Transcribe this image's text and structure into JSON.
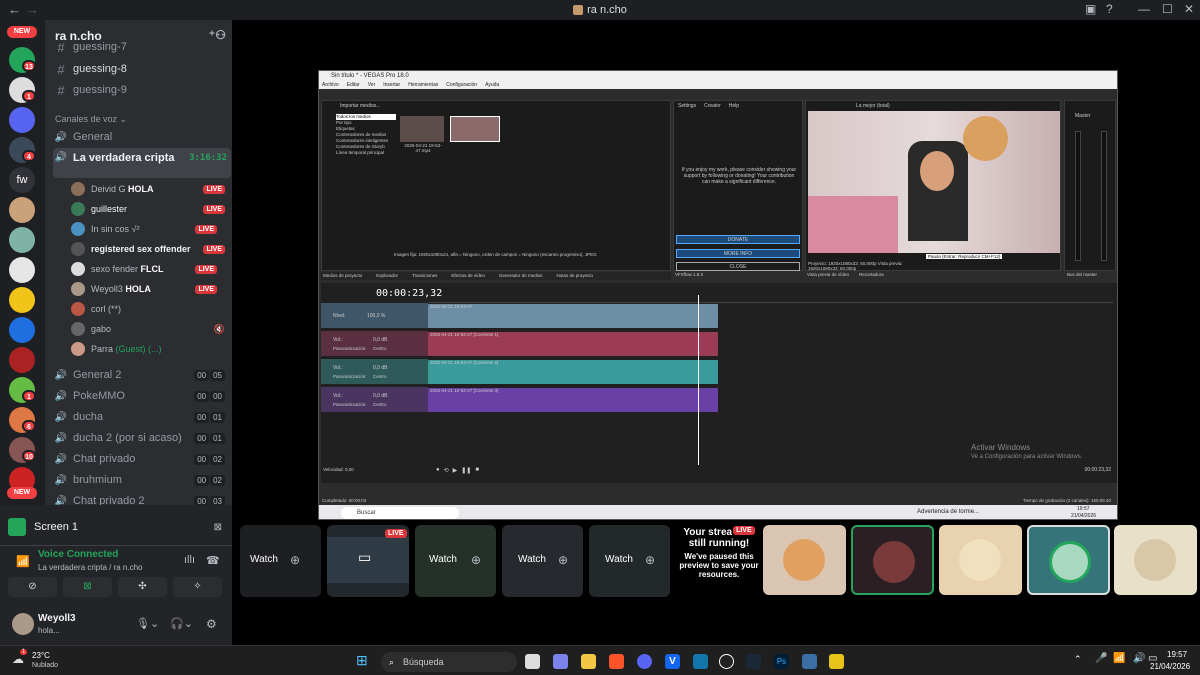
{
  "window": {
    "title": "ra n.cho",
    "back": "←",
    "forward": "→"
  },
  "server_badges": {
    "new_top": "NEW",
    "b1": "13",
    "b2": "1",
    "b3": "4",
    "b4": "1",
    "b5": "6",
    "b6": "10",
    "new_bottom": "NEW",
    "fw": "fw"
  },
  "guild": {
    "name": "ra n.cho"
  },
  "text_channels": [
    "guessing-7",
    "guessing-8",
    "guessing-9"
  ],
  "voice_category": "Canales de voz",
  "voice_channels": {
    "general": "General",
    "active": "La verdadera cripta",
    "active_time": "3:16:32",
    "general2": "General 2",
    "pokemmo": "PokeMMO",
    "ducha": "ducha",
    "ducha2": "ducha 2 (por si acaso)",
    "chat_privado": "Chat privado",
    "bruhmium": "bruhmium",
    "chat_privado2": "Chat privado 2"
  },
  "counters": {
    "general2": [
      "00",
      "05"
    ],
    "pokemmo": [
      "00",
      "00"
    ],
    "ducha": [
      "00",
      "01"
    ],
    "ducha2": [
      "00",
      "01"
    ],
    "chat_privado": [
      "00",
      "02"
    ],
    "bruhmium": [
      "00",
      "02"
    ],
    "chat_privado2": [
      "00",
      "03"
    ]
  },
  "voice_users": [
    {
      "name": "Deivid G",
      "tag": "HOLA",
      "live": "LIVE"
    },
    {
      "name": "guillester",
      "tag": "",
      "live": "LIVE"
    },
    {
      "name": "In sin cos √²",
      "tag": "",
      "live": "LIVE"
    },
    {
      "name": "registered sex offender",
      "tag": "",
      "live": "LIVE"
    },
    {
      "name": "sexo fender",
      "tag": "FLCL",
      "live": "LIVE"
    },
    {
      "name": "Weyoll3",
      "tag": "HOLA",
      "live": "LIVE"
    },
    {
      "name": "corl",
      "tag": "(**)",
      "live": ""
    },
    {
      "name": "gabo",
      "tag": "",
      "live": ""
    },
    {
      "name": "Parra",
      "tag": "(Guest) (...)",
      "live": ""
    }
  ],
  "panel": {
    "screen": "Screen 1",
    "voice_connected": "Voice Connected",
    "voice_location": "La verdadera cripta / ra n.cho",
    "username": "Weyoll3",
    "status": "hola..."
  },
  "vegas": {
    "title": "Sin título * - VEGAS Pro 18.0",
    "menu": [
      "Archivo",
      "Editar",
      "Ver",
      "Insertar",
      "Herramientas",
      "Configuración",
      "Ayuda"
    ],
    "media_tree": [
      "Todos los medios",
      "Por tipo",
      "Etiquetas",
      "Contenedores de medios",
      "Contenedores inteligentes",
      "Contenedores de Storyb",
      "Línea temporal principal"
    ],
    "import_label": "Importar medios...",
    "file_name": "2026-04-21 19-53-47.mp4",
    "media_info": "Imagen fija: 1920x1080x24, alfa = Ninguno, orden de campos = Ninguno (escaneo progresivo), JPEG",
    "tabs": [
      "Medios de proyecto",
      "Explorador",
      "Transiciones",
      "Efectos de vídeo",
      "Generador de medios",
      "Notas de proyecto"
    ],
    "plugin_menu": [
      "Settings",
      "Creator",
      "Help"
    ],
    "plugin_text": "If you enjoy my work, please consider showing your support by following or donating! Your contribution can make a significant difference.",
    "plugin_buttons": [
      "DONATE",
      "MORE INFO",
      "CLOSE"
    ],
    "plugin_tab": "VFXflow 1.8.3",
    "preview_label": "La mejor (total)",
    "preview_info": "Proyecto: 1920x1080x32; 60,000p  Vista previa: 1920x1080x32; 60,000p",
    "preview_tabs": [
      "Vista previa de vídeo",
      "Recortadora"
    ],
    "master": "Master",
    "master_tab": "Bus del master",
    "timecode": "00:00:23,32",
    "tracks": [
      {
        "label": "Nivel:",
        "value": "100,0 %",
        "clip": "2026-04-21 19-53-47"
      },
      {
        "label": "Vol.:",
        "value": "0,0 dB",
        "clip": "2026-04-21 19-53-47 [Corriente 1]"
      },
      {
        "label": "Vol.:",
        "value": "0,0 dB",
        "clip": "2026-04-21 19-53-47 [Corriente 2]"
      },
      {
        "label": "Vol.:",
        "value": "0,0 dB",
        "clip": "2026-04-21 19-53-47 [Corriente 3]"
      }
    ],
    "pan_label": "Panoramización:",
    "pan_value": "Centro",
    "rate": "Velocidad: 0,00",
    "footer_timecode": "00:00:23,32",
    "status_left": "Completado: 00:00:03",
    "status_right": "Tiempo de grabación (2 canales): 160:05:40",
    "tooltip": "Pausa (Entrar: Reproducir CM+F12)",
    "watermark_1": "Activar Windows",
    "watermark_2": "Ve a Configuración para activar Windows.",
    "inner_search": "Buscar",
    "inner_weather": "Advertencia de torme...",
    "inner_time": "19:57",
    "inner_date": "21/04/2026"
  },
  "watch_buttons": [
    "Watch",
    "Watch",
    "Watch",
    "Watch"
  ],
  "live_tag": "LIVE",
  "paused_card": {
    "line1": "Your strea",
    "line2": "still running!",
    "body": "We've paused this preview to save your resources."
  },
  "taskbar": {
    "temp": "23°C",
    "weather": "Nublado",
    "weather_badge": "1",
    "search": "Búsqueda",
    "time": "19:57",
    "date": "21/04/2026"
  }
}
